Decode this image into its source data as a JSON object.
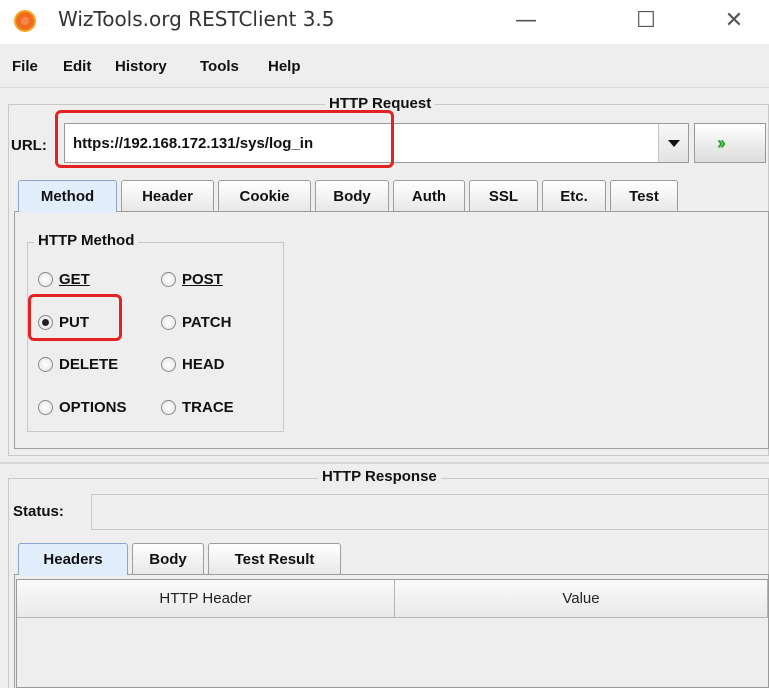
{
  "window": {
    "title": "WizTools.org RESTClient 3.5",
    "min_glyph": "—",
    "max_glyph": "☐",
    "close_glyph": "✕"
  },
  "menu": {
    "items": [
      {
        "label": "File"
      },
      {
        "label": "Edit"
      },
      {
        "label": "History"
      },
      {
        "label": "Tools"
      },
      {
        "label": "Help"
      }
    ]
  },
  "request": {
    "group_title": "HTTP Request",
    "url_label": "URL:",
    "url_value": "https://192.168.172.131/sys/log_in",
    "go_icon": "go-icon",
    "go_glyph": "››",
    "tabs": [
      {
        "label": "Method",
        "active": true
      },
      {
        "label": "Header"
      },
      {
        "label": "Cookie"
      },
      {
        "label": "Body"
      },
      {
        "label": "Auth"
      },
      {
        "label": "SSL"
      },
      {
        "label": "Etc."
      },
      {
        "label": "Test"
      }
    ],
    "method_group_title": "HTTP Method",
    "methods": [
      {
        "label": "GET",
        "checked": false
      },
      {
        "label": "POST",
        "checked": false
      },
      {
        "label": "PUT",
        "checked": true
      },
      {
        "label": "PATCH",
        "checked": false
      },
      {
        "label": "DELETE",
        "checked": false
      },
      {
        "label": "HEAD",
        "checked": false
      },
      {
        "label": "OPTIONS",
        "checked": false
      },
      {
        "label": "TRACE",
        "checked": false
      }
    ],
    "selected_method": "PUT"
  },
  "response": {
    "group_title": "HTTP Response",
    "status_label": "Status:",
    "tabs": [
      {
        "label": "Headers",
        "active": true
      },
      {
        "label": "Body"
      },
      {
        "label": "Test Result"
      }
    ],
    "table_columns": [
      "HTTP Header",
      "Value"
    ]
  },
  "colors": {
    "highlight": "#e32222",
    "go_arrow": "#22a322",
    "app_icon": "#f26b1d"
  }
}
